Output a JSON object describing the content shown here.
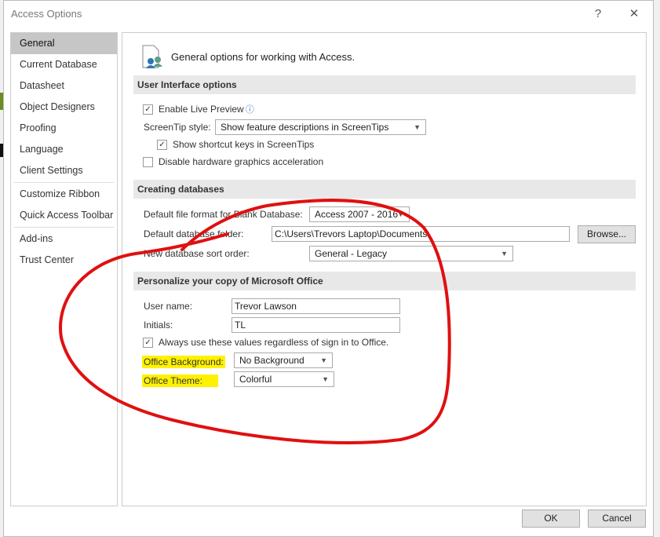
{
  "window": {
    "title": "Access Options",
    "help": "?",
    "close": "✕"
  },
  "nav": [
    "General",
    "Current Database",
    "Datasheet",
    "Object Designers",
    "Proofing",
    "Language",
    "Client Settings",
    "Customize Ribbon",
    "Quick Access Toolbar",
    "Add-ins",
    "Trust Center"
  ],
  "header": "General options for working with Access.",
  "ui": {
    "section": "User Interface options",
    "live_preview": "Enable Live Preview",
    "screentip_label": "ScreenTip style:",
    "screentip_value": "Show feature descriptions in ScreenTips",
    "shortcut_keys": "Show shortcut keys in ScreenTips",
    "disable_hw": "Disable hardware graphics acceleration"
  },
  "create": {
    "section": "Creating databases",
    "format_label": "Default file format for Blank Database:",
    "format_value": "Access 2007 - 2016",
    "folder_label": "Default database folder:",
    "folder_value": "C:\\Users\\Trevors Laptop\\Documents\\",
    "browse": "Browse...",
    "sort_label": "New database sort order:",
    "sort_value": "General - Legacy"
  },
  "personal": {
    "section": "Personalize your copy of Microsoft Office",
    "user_label": "User name:",
    "user_value": "Trevor Lawson",
    "initials_label": "Initials:",
    "initials_value": "TL",
    "always_use": "Always use these values regardless of sign in to Office.",
    "bg_label": "Office Background:",
    "bg_value": "No Background",
    "theme_label": "Office Theme:",
    "theme_value": "Colorful"
  },
  "buttons": {
    "ok": "OK",
    "cancel": "Cancel"
  },
  "colors": {
    "annotation": "#e01010",
    "highlight": "#fff200"
  }
}
